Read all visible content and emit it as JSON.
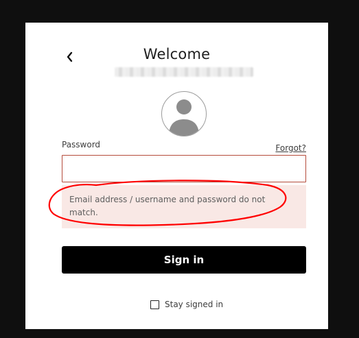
{
  "login": {
    "title": "Welcome",
    "back_icon": "chevron-left-icon",
    "avatar_icon": "user-icon",
    "password": {
      "label": "Password",
      "value": "",
      "placeholder": ""
    },
    "forgot_label": "Forgot?",
    "error_message": "Email address / username and password do not match.",
    "sign_in_label": "Sign in",
    "stay_signed_in": {
      "label": "Stay signed in",
      "checked": false
    }
  },
  "annotation": {
    "color": "#ff0000"
  },
  "colors": {
    "error_border": "#b44a3a",
    "error_bg": "#f9e8e5",
    "button_bg": "#000000"
  }
}
